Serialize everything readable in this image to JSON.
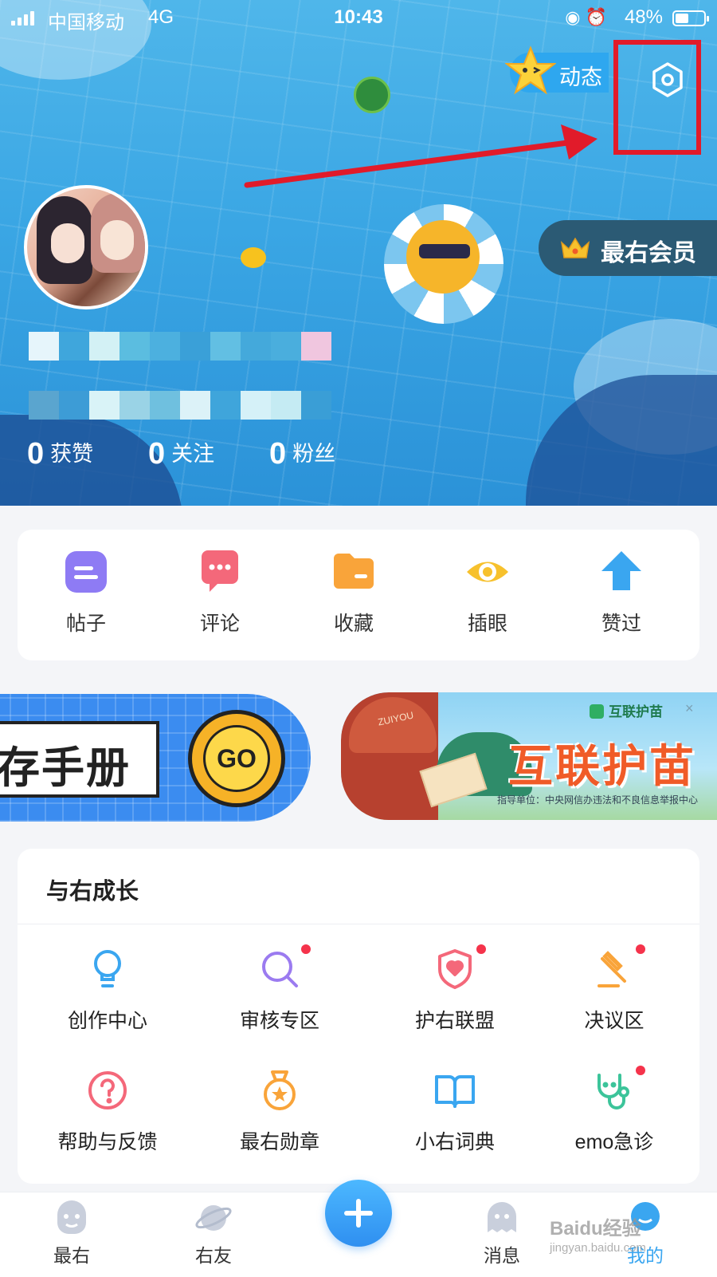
{
  "status_bar": {
    "carrier": "中国移动",
    "network": "4G",
    "time": "10:43",
    "battery_percent": "48%",
    "battery_level": 0.48
  },
  "header": {
    "dongtai_label": "动态",
    "vip_label": "最右会员"
  },
  "profile": {
    "stats": [
      {
        "value": "0",
        "label": "获赞"
      },
      {
        "value": "0",
        "label": "关注"
      },
      {
        "value": "0",
        "label": "粉丝"
      }
    ]
  },
  "quick_actions": [
    {
      "label": "帖子",
      "icon": "post-icon",
      "color": "#8e7bf4"
    },
    {
      "label": "评论",
      "icon": "comment-icon",
      "color": "#f4687a"
    },
    {
      "label": "收藏",
      "icon": "folder-icon",
      "color": "#f9a43a"
    },
    {
      "label": "插眼",
      "icon": "eye-icon",
      "color": "#f7c12d"
    },
    {
      "label": "赞过",
      "icon": "thumb-up-arrow-icon",
      "color": "#3aa6f0"
    }
  ],
  "banners": {
    "left_text": "存手册",
    "left_button": "GO",
    "right_badge": "互联护苗",
    "right_close": "×",
    "right_title": "互联护苗",
    "right_note": "指导单位：中央网信办违法和不良信息举报中心",
    "mailbox_text": "ZUIYOU"
  },
  "growth": {
    "title": "与右成长",
    "items": [
      {
        "label": "创作中心",
        "icon": "lightbulb-icon",
        "badge": false
      },
      {
        "label": "审核专区",
        "icon": "magnifier-icon",
        "badge": true
      },
      {
        "label": "护右联盟",
        "icon": "shield-heart-icon",
        "badge": true
      },
      {
        "label": "决议区",
        "icon": "gavel-icon",
        "badge": true
      },
      {
        "label": "帮助与反馈",
        "icon": "question-icon",
        "badge": false
      },
      {
        "label": "最右勋章",
        "icon": "medal-icon",
        "badge": false
      },
      {
        "label": "小右词典",
        "icon": "book-icon",
        "badge": false
      },
      {
        "label": "emo急诊",
        "icon": "stethoscope-icon",
        "badge": true
      }
    ]
  },
  "tabbar": {
    "tabs": [
      {
        "label": "最右",
        "icon": "zuiyou-face-icon",
        "active": false
      },
      {
        "label": "右友",
        "icon": "planet-icon",
        "active": false
      },
      {
        "label": "消息",
        "icon": "message-ghost-icon",
        "active": false
      },
      {
        "label": "我的",
        "icon": "me-icon",
        "active": true
      }
    ],
    "post_button": "plus-icon"
  },
  "watermark": {
    "text": "Baidu经验",
    "sub": "jingyan.baidu.com"
  },
  "colors": {
    "accent": "#3aa6f0",
    "highlight_red": "#e11b2a",
    "badge_red": "#f5334b"
  }
}
